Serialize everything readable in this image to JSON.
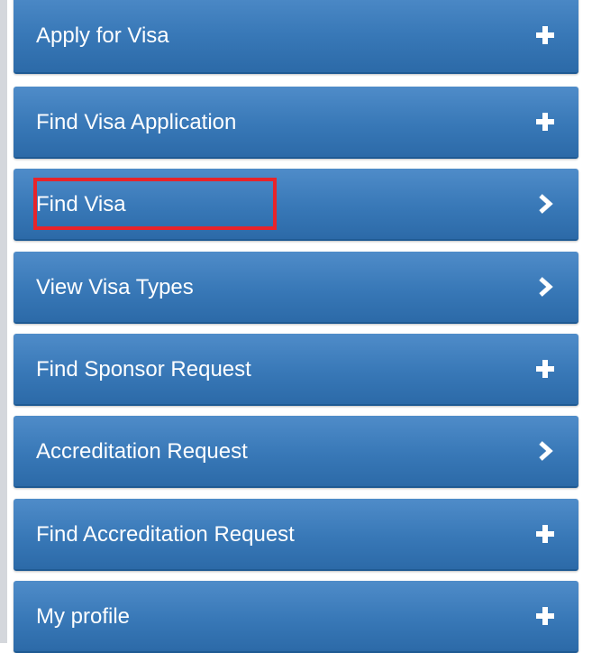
{
  "menu": {
    "items": [
      {
        "label": "Apply for Visa",
        "icon": "plus-icon"
      },
      {
        "label": "Find Visa Application",
        "icon": "plus-icon"
      },
      {
        "label": "Find Visa",
        "icon": "chevron-right-icon",
        "highlighted": true
      },
      {
        "label": "View Visa Types",
        "icon": "chevron-right-icon"
      },
      {
        "label": "Find Sponsor Request",
        "icon": "plus-icon"
      },
      {
        "label": "Accreditation Request",
        "icon": "chevron-right-icon"
      },
      {
        "label": "Find Accreditation Request",
        "icon": "plus-icon"
      },
      {
        "label": "My profile",
        "icon": "plus-icon"
      }
    ]
  },
  "colors": {
    "item_background": "#3878b7",
    "item_text": "#ffffff",
    "highlight_border": "#e8242a",
    "left_rule": "#d4d7dc"
  }
}
